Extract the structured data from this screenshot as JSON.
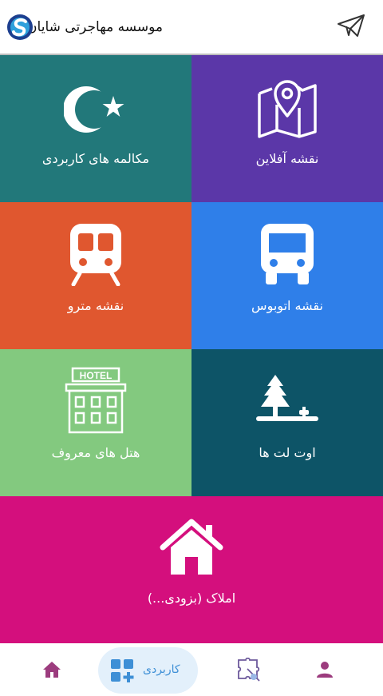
{
  "header": {
    "title": "موسسه مهاجرتی شایان",
    "send_icon": "paper-plane-icon",
    "logo_icon": "shayan-logo-icon"
  },
  "tiles": [
    {
      "label": "نقشه آفلاین",
      "icon": "map-pin-icon",
      "color": "#5b37a8"
    },
    {
      "label": "مکالمه های کاربردی",
      "icon": "crescent-star-icon",
      "color": "#22787a"
    },
    {
      "label": "نقشه اتوبوس",
      "icon": "bus-icon",
      "color": "#2f7fe9"
    },
    {
      "label": "نقشه مترو",
      "icon": "metro-train-icon",
      "color": "#e0572f"
    },
    {
      "label": "اوت لت ها",
      "icon": "tree-outlet-icon",
      "color": "#0d5467"
    },
    {
      "label": "هتل های معروف",
      "icon": "hotel-icon",
      "color": "#83c97f",
      "sign": "HOTEL"
    },
    {
      "label": "املاک (بزودی...)",
      "icon": "house-icon",
      "color": "#d40f7d"
    }
  ],
  "bottom_nav": {
    "home_icon": "home-icon",
    "apps_label": "کاربردی",
    "apps_icon": "apps-plus-icon",
    "puzzle_icon": "puzzle-icon",
    "profile_icon": "person-icon",
    "active_color": "#3d8fd6",
    "inactive_color": "#9c3c7e"
  }
}
